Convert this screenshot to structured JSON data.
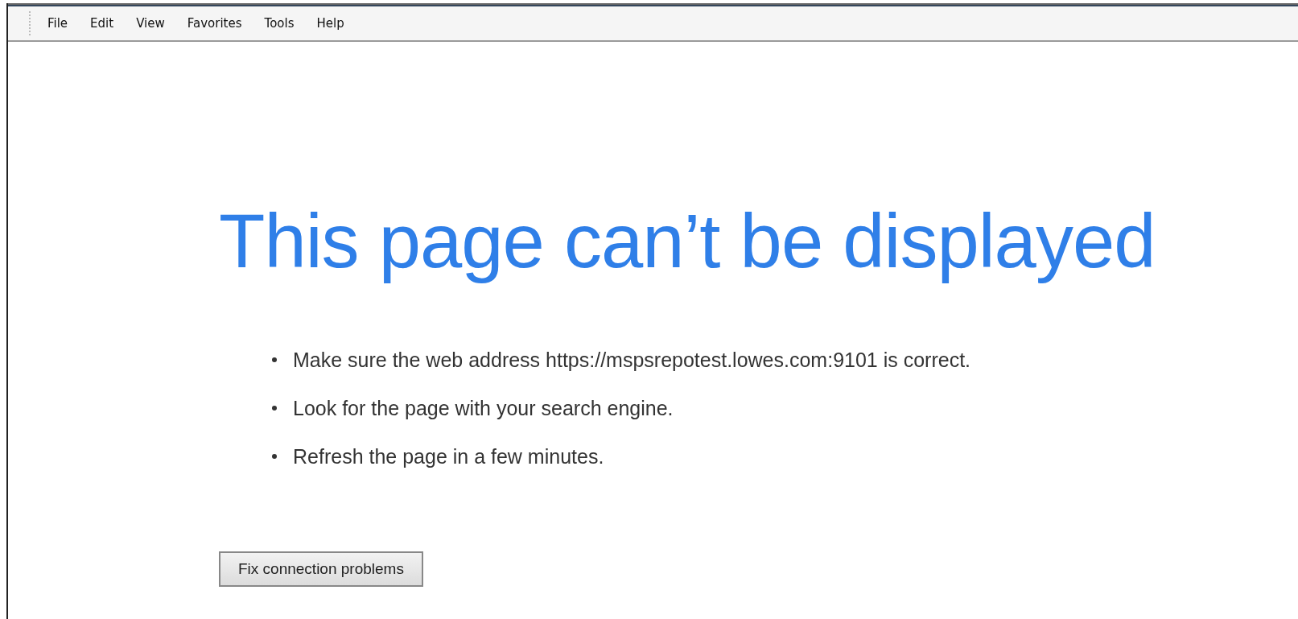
{
  "menu_bar": {
    "items": [
      "File",
      "Edit",
      "View",
      "Favorites",
      "Tools",
      "Help"
    ]
  },
  "error_page": {
    "title": "This page can’t be displayed",
    "suggestions": [
      "Make sure the web address https://mspsrepotest.lowes.com:9101 is correct.",
      "Look for the page with your search engine.",
      "Refresh the page in a few minutes."
    ],
    "button": "Fix connection problems"
  }
}
